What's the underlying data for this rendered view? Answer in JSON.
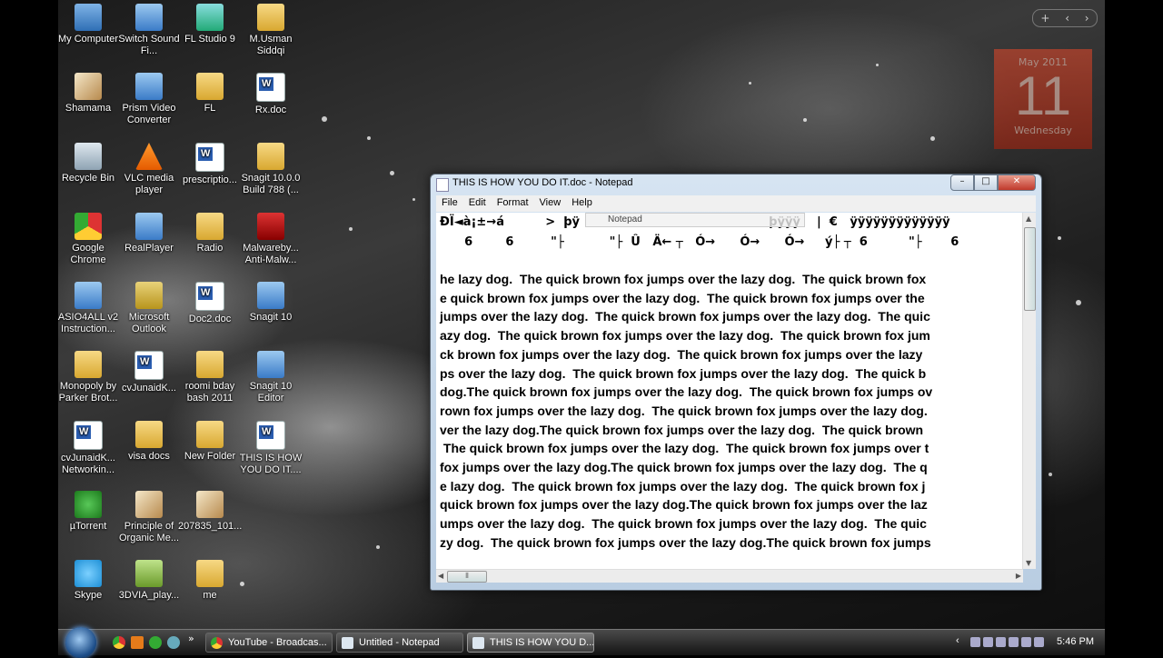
{
  "desktop": {
    "icons": [
      {
        "label": "My Computer"
      },
      {
        "label": "Switch Sound Fi..."
      },
      {
        "label": "FL Studio 9"
      },
      {
        "label": "M.Usman Siddqi"
      },
      {
        "label": "Shamama"
      },
      {
        "label": "Prism Video Converter"
      },
      {
        "label": "FL"
      },
      {
        "label": "Rx.doc"
      },
      {
        "label": "Recycle Bin"
      },
      {
        "label": "VLC media player"
      },
      {
        "label": "prescriptio..."
      },
      {
        "label": "Snagit 10.0.0 Build 788 (..."
      },
      {
        "label": "Google Chrome"
      },
      {
        "label": "RealPlayer"
      },
      {
        "label": "Radio"
      },
      {
        "label": "Malwareby... Anti-Malw..."
      },
      {
        "label": "ASIO4ALL v2 Instruction..."
      },
      {
        "label": "Microsoft Outlook"
      },
      {
        "label": "Doc2.doc"
      },
      {
        "label": "Snagit 10"
      },
      {
        "label": "Monopoly by Parker Brot..."
      },
      {
        "label": "cvJunaidK..."
      },
      {
        "label": "roomi bday bash 2011"
      },
      {
        "label": "Snagit 10 Editor"
      },
      {
        "label": "cvJunaidK... Networkin..."
      },
      {
        "label": "visa docs"
      },
      {
        "label": "New Folder"
      },
      {
        "label": "THIS IS HOW YOU DO IT...."
      },
      {
        "label": "µTorrent"
      },
      {
        "label": "Principle of Organic Me..."
      },
      {
        "label": "207835_101..."
      },
      {
        "label": "Skype"
      },
      {
        "label": "3DVIA_play..."
      },
      {
        "label": "me"
      }
    ]
  },
  "gadgets": {
    "bar": {
      "add": "+",
      "prev": "‹",
      "next": "›"
    },
    "calendar": {
      "month": "May 2011",
      "day": "11",
      "weekday": "Wednesday"
    }
  },
  "notepad": {
    "title": "THIS IS HOW YOU DO IT.doc - Notepad",
    "buttons": {
      "minimize": "–",
      "maximize": "□",
      "close": "✕"
    },
    "menu": [
      "File",
      "Edit",
      "Format",
      "View",
      "Help"
    ],
    "tooltip": "Notepad",
    "garbage_lines": [
      "ÐÏ◄à¡±→á          >  þÿ                                              þÿÿÿ    |  €   ÿÿÿÿÿÿÿÿÿÿÿÿÿ",
      "      6        6         \"├           \"├  Û   Ä← ┬   Ó→      Ó→      Ó→     ý├ ┬  6          \"├       6"
    ],
    "lines": [
      "he lazy dog.  The quick brown fox jumps over the lazy dog.  The quick brown fox",
      "e quick brown fox jumps over the lazy dog.  The quick brown fox jumps over the",
      "jumps over the lazy dog.  The quick brown fox jumps over the lazy dog.  The quic",
      "azy dog.  The quick brown fox jumps over the lazy dog.  The quick brown fox jum",
      "ck brown fox jumps over the lazy dog.  The quick brown fox jumps over the lazy",
      "ps over the lazy dog.  The quick brown fox jumps over the lazy dog.  The quick b",
      "dog.The quick brown fox jumps over the lazy dog.  The quick brown fox jumps ov",
      "rown fox jumps over the lazy dog.  The quick brown fox jumps over the lazy dog.",
      "ver the lazy dog.The quick brown fox jumps over the lazy dog.  The quick brown",
      " The quick brown fox jumps over the lazy dog.  The quick brown fox jumps over t",
      "fox jumps over the lazy dog.The quick brown fox jumps over the lazy dog.  The q",
      "e lazy dog.  The quick brown fox jumps over the lazy dog.  The quick brown fox j",
      "quick brown fox jumps over the lazy dog.The quick brown fox jumps over the laz",
      "umps over the lazy dog.  The quick brown fox jumps over the lazy dog.  The quic",
      "zy dog.  The quick brown fox jumps over the lazy dog.The quick brown fox jumps"
    ]
  },
  "taskbar": {
    "tasks": [
      {
        "label": "YouTube - Broadcas..."
      },
      {
        "label": "Untitled - Notepad"
      },
      {
        "label": "THIS IS HOW YOU D..."
      }
    ],
    "show_more": "»",
    "tray_arrow": "‹",
    "clock": "5:46 PM"
  }
}
